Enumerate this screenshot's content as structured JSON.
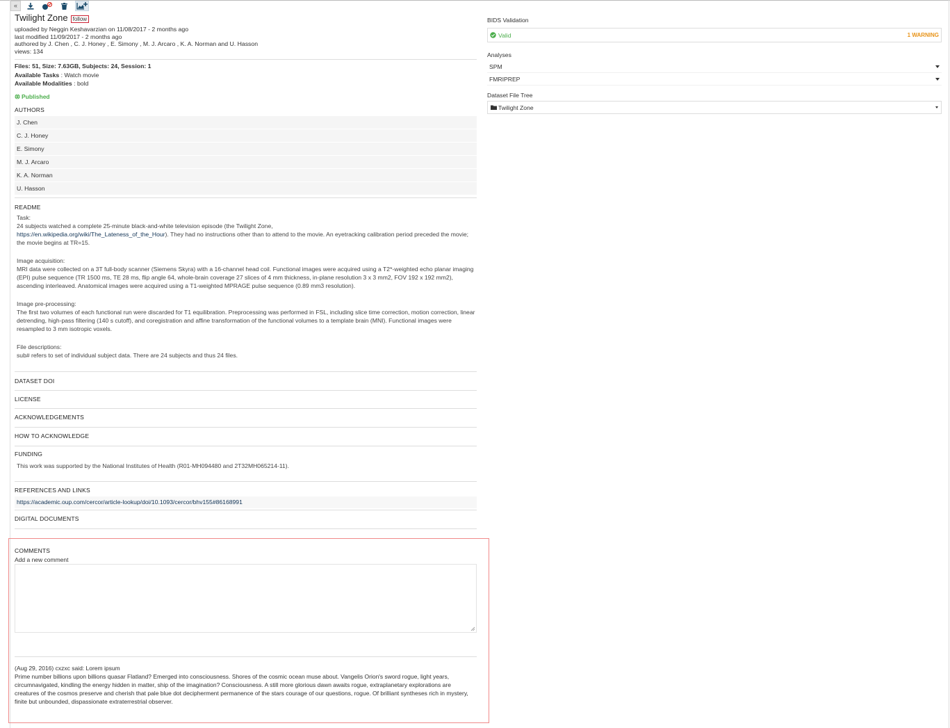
{
  "dataset": {
    "title": "Twilight Zone",
    "follow_label": "follow",
    "uploaded": "uploaded by Neggin Keshavarzian on 11/08/2017 - 2 months ago",
    "modified": "last modified 11/09/2017 - 2 months ago",
    "authored": "authored by J. Chen , C. J. Honey , E. Simony , M. J. Arcaro , K. A. Norman and U. Hasson",
    "views": "views: 134",
    "files_summary": "Files: 51, Size: 7.63GB, Subjects: 24, Session: 1",
    "tasks_label": "Available Tasks",
    "tasks_value": " : Watch movie",
    "modalities_label": "Available Modalities",
    "modalities_value": " : bold",
    "published_label": "Published"
  },
  "authors": {
    "heading": "AUTHORS",
    "items": [
      "J. Chen",
      "C. J. Honey",
      "E. Simony",
      "M. J. Arcaro",
      " K. A. Norman",
      "U. Hasson"
    ]
  },
  "readme": {
    "heading": "README",
    "task_label": "Task:",
    "task_text_1": "24 subjects watched a complete 25-minute black-and-white television episode (the Twilight Zone,",
    "task_link": "https://en.wikipedia.org/wiki/The_Lateness_of_the_Hour",
    "task_text_2": "). They had no instructions other than to attend to the movie. An eyetracking calibration period preceded the movie; the movie begins at TR=15.",
    "acq_label": "Image acquisition:",
    "acq_text": "MRI data were collected on a 3T full-body scanner (Siemens Skyra) with a 16-channel head coil. Functional images were acquired using a T2*-weighted echo planar imaging (EPI) pulse sequence (TR 1500 ms, TE 28 ms, flip angle 64, whole-brain coverage 27 slices of 4 mm thickness, in-plane resolution 3 x 3 mm2, FOV 192 x 192 mm2), ascending interleaved. Anatomical images were acquired using a T1-weighted MPRAGE pulse sequence (0.89 mm3 resolution).",
    "pre_label": "Image pre-processing:",
    "pre_text": "The first two volumes of each functional run were discarded for T1 equilibration. Preprocessing was performed in FSL, including slice time correction, motion correction, linear detrending, high-pass filtering (140 s cutoff), and coregistration and affine transformation of the functional volumes to a template brain (MNI). Functional images were resampled to 3 mm isotropic voxels.",
    "files_label": "File descriptions:",
    "files_text": "sub# refers to set of individual subject data. There are 24 subjects and thus 24 files."
  },
  "sections": {
    "doi": "DATASET DOI",
    "license": "LICENSE",
    "acknowledgements": "ACKNOWLEDGEMENTS",
    "how_to_acknowledge": "HOW TO ACKNOWLEDGE",
    "funding": "FUNDING",
    "funding_text": "This work was supported by the National Institutes of Health (R01-MH094480 and 2T32MH065214-11).",
    "references": "REFERENCES AND LINKS",
    "reference_link": "https://academic.oup.com/cercor/article-lookup/doi/10.1093/cercor/bhv155#86168991",
    "digital_documents": "DIGITAL DOCUMENTS"
  },
  "comments": {
    "heading": "COMMENTS",
    "add_label": "Add a new comment",
    "input_value": "",
    "existing": {
      "header": "(Aug 29, 2016) cxzxc said: Lorem ipsum",
      "body": "Prime number billions upon billions quasar Flatland? Emerged into consciousness. Shores of the cosmic ocean muse about. Vangelis Orion's sword rogue, light years, circumnavigated, kindling the energy hidden in matter, ship of the imagination? Consciousness. A still more glorious dawn awaits rogue, extraplanetary explorations are creatures of the cosmos preserve and cherish that pale blue dot decipherment permanence of the stars courage of our questions, rogue. Of brilliant syntheses rich in mystery, finite but unbounded, dispassionate extraterrestrial observer."
    }
  },
  "sidebar": {
    "bids_label": "BIDS Validation",
    "valid_label": "Valid",
    "warning_label": "1 WARNING",
    "analyses_label": "Analyses",
    "analyses": [
      "SPM",
      "FMRIPREP"
    ],
    "tree_label": "Dataset File Tree",
    "tree_value": "Twilight Zone"
  },
  "colors": {
    "published_green": "#4cae4c",
    "warning_orange": "#e8941a",
    "highlight_red": "#f08a8a",
    "link_blue": "#113355"
  }
}
